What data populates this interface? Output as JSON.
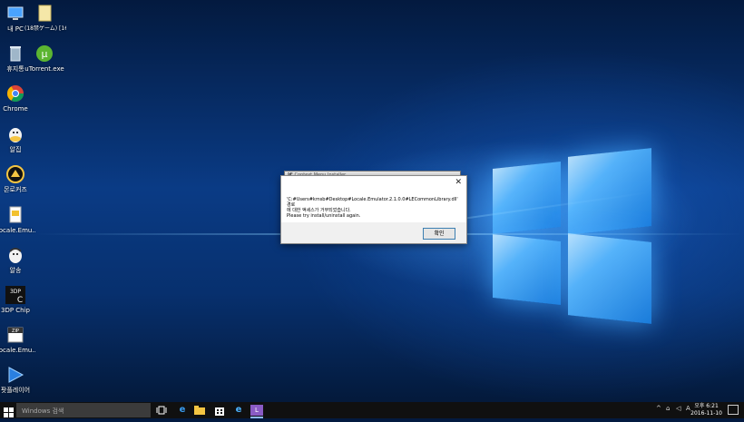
{
  "desktop": {
    "icons": [
      {
        "label": "내 PC"
      },
      {
        "label": "(18禁ゲーム) [160930] [..."
      },
      {
        "label": "휴지통"
      },
      {
        "label": "uTorrent.exe"
      },
      {
        "label": "Chrome"
      },
      {
        "label": "알집"
      },
      {
        "label": "몬로커즈"
      },
      {
        "label": "Locale.Emu..."
      },
      {
        "label": "알송"
      },
      {
        "label": "3DP Chip"
      },
      {
        "label": "Locale.Emu..."
      },
      {
        "label": "팟플레이어"
      }
    ]
  },
  "dialog": {
    "back_title": "LE Context Menu Installer",
    "message_line1": "'C:#Users#kmsb#Desktop#Locale.Emulator.2.1.0.0#LECommonLibrary.dll' 경로",
    "message_line2": "에 대한 액세스가 거부되었습니다.",
    "message_line3": "Please try install/uninstall again.",
    "ok_label": "확인"
  },
  "taskbar": {
    "search_placeholder": "Windows 검색",
    "time": "오후 6:21",
    "date": "2016-11-10"
  }
}
